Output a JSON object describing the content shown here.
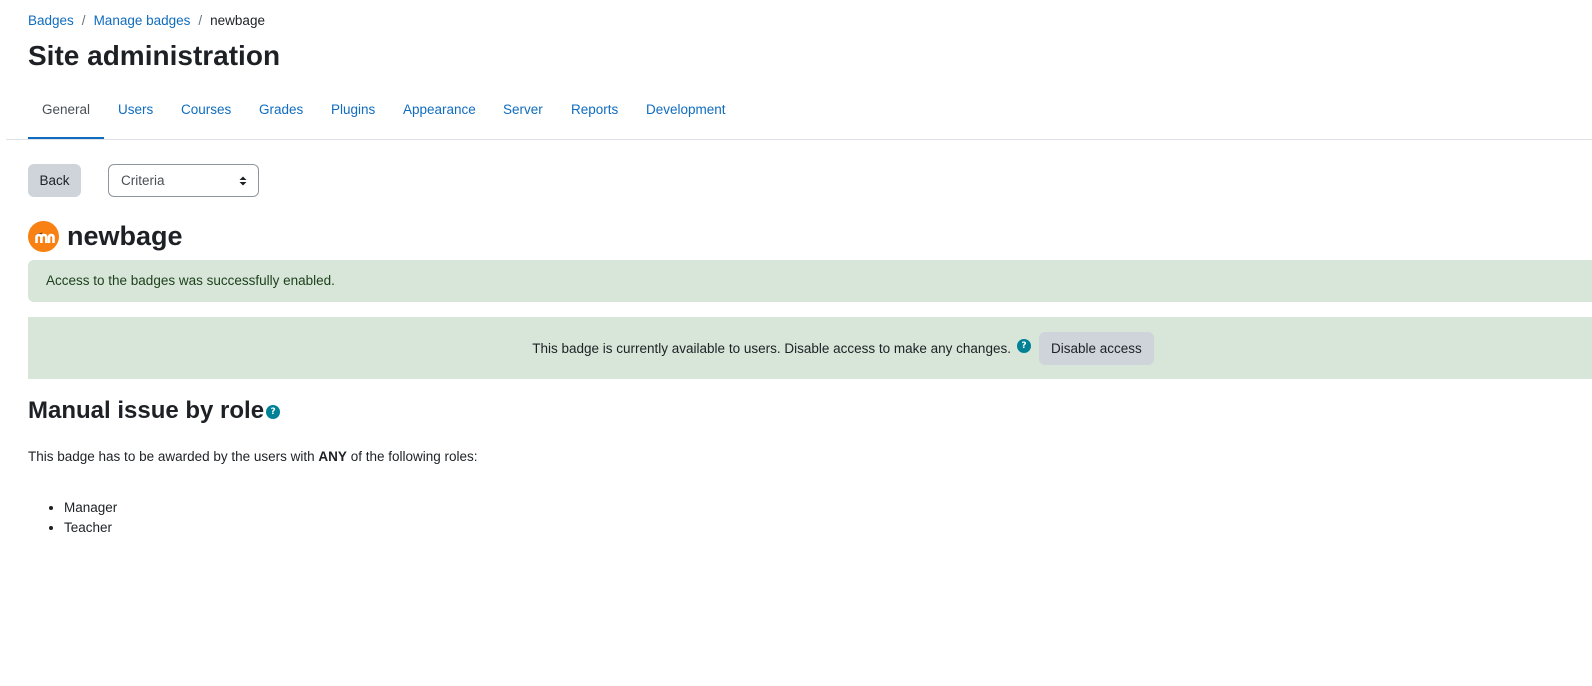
{
  "breadcrumb": {
    "items": [
      "Badges",
      "Manage badges"
    ],
    "separator": "/",
    "current": "newbage"
  },
  "page_title": "Site administration",
  "tabs": [
    "General",
    "Users",
    "Courses",
    "Grades",
    "Plugins",
    "Appearance",
    "Server",
    "Reports",
    "Development"
  ],
  "active_tab": "General",
  "toolbar": {
    "back_label": "Back",
    "select_value": "Criteria"
  },
  "badge": {
    "name": "newbage",
    "logo_icon": "moodle-logo-icon"
  },
  "alert": {
    "message": "Access to the badges was successfully enabled."
  },
  "status": {
    "message": "This badge is currently available to users. Disable access to make any changes.",
    "help_icon": "?",
    "disable_label": "Disable access"
  },
  "criteria": {
    "heading": "Manual issue by role",
    "help_icon": "?",
    "description_prefix": "This badge has to be awarded by the users with ",
    "description_emphasis": "ANY",
    "description_suffix": " of the following roles:",
    "roles": [
      "Manager",
      "Teacher"
    ]
  },
  "colors": {
    "link": "#0f6cbf",
    "brand_orange": "#f98012",
    "success_bg": "#d7e6d9",
    "help_teal": "#008196",
    "button_gray": "#ced4da"
  }
}
